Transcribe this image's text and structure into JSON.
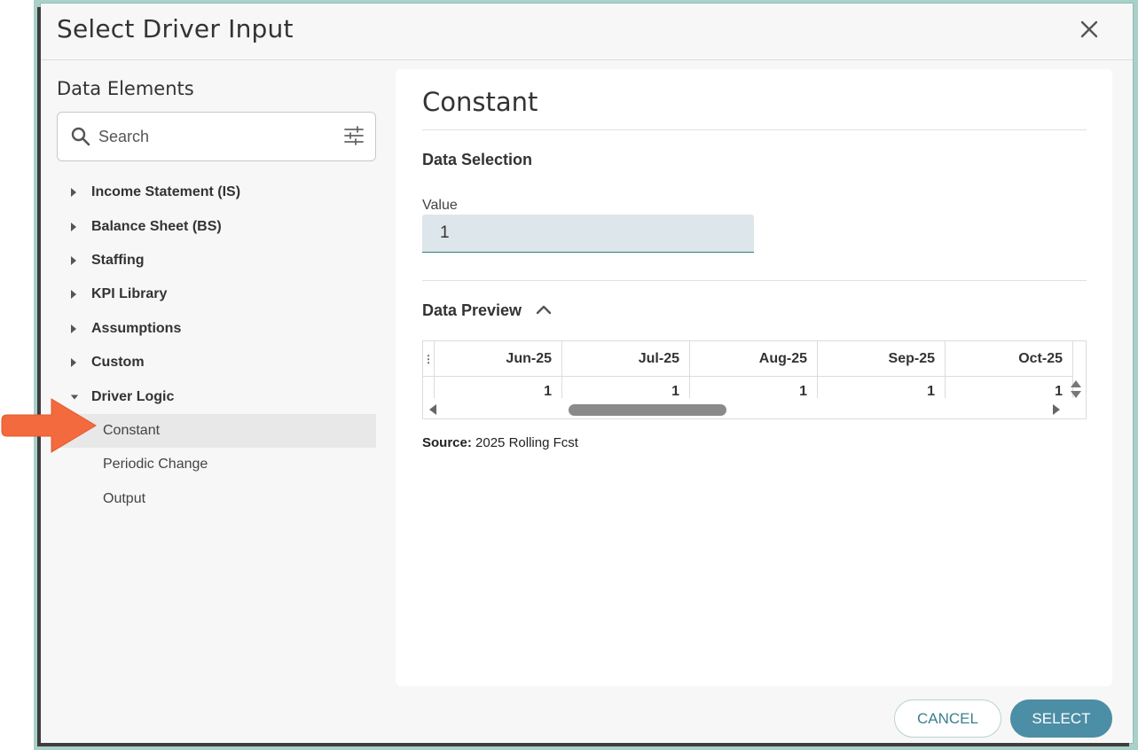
{
  "dialog": {
    "title": "Select Driver Input",
    "close_icon": "close-icon"
  },
  "left_panel": {
    "heading": "Data Elements",
    "search": {
      "placeholder": "Search",
      "value": ""
    },
    "tree": [
      {
        "label": "Income Statement (IS)",
        "expanded": false
      },
      {
        "label": "Balance Sheet (BS)",
        "expanded": false
      },
      {
        "label": "Staffing",
        "expanded": false
      },
      {
        "label": "KPI Library",
        "expanded": false
      },
      {
        "label": "Assumptions",
        "expanded": false
      },
      {
        "label": "Custom",
        "expanded": false
      },
      {
        "label": "Driver Logic",
        "expanded": true,
        "children": [
          {
            "label": "Constant",
            "selected": true
          },
          {
            "label": "Periodic Change",
            "selected": false
          },
          {
            "label": "Output",
            "selected": false
          }
        ]
      }
    ]
  },
  "content": {
    "title": "Constant",
    "data_selection": {
      "heading": "Data Selection",
      "value_label": "Value",
      "value": "1"
    },
    "data_preview": {
      "heading": "Data Preview",
      "columns": [
        "Jun-25",
        "Jul-25",
        "Aug-25",
        "Sep-25",
        "Oct-25"
      ],
      "row": [
        "1",
        "1",
        "1",
        "1",
        "1"
      ],
      "source_label": "Source:",
      "source_value": "2025 Rolling Fcst"
    }
  },
  "footer": {
    "cancel_label": "CANCEL",
    "select_label": "SELECT"
  },
  "colors": {
    "accent": "#4c8ea5",
    "annotation_arrow": "#f26a3d",
    "frame": "#a9d0c9"
  }
}
